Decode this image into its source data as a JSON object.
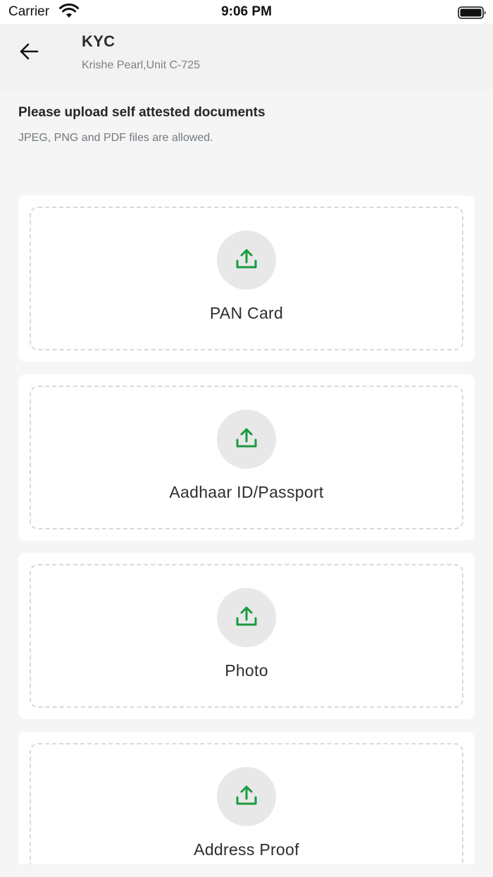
{
  "status_bar": {
    "carrier": "Carrier",
    "time": "9:06 PM"
  },
  "header": {
    "title": "KYC",
    "subtitle": "Krishe Pearl,Unit C-725",
    "back_icon": "arrow-left-icon"
  },
  "instructions": {
    "title": "Please upload self attested documents",
    "subtitle": "JPEG, PNG and PDF files are allowed."
  },
  "uploads": [
    {
      "label": "PAN Card",
      "icon": "upload-icon"
    },
    {
      "label": "Aadhaar ID/Passport",
      "icon": "upload-icon"
    },
    {
      "label": "Photo",
      "icon": "upload-icon"
    },
    {
      "label": "Address Proof",
      "icon": "upload-icon"
    }
  ],
  "colors": {
    "accent": "#1a9a3f",
    "background": "#f5f5f5",
    "card": "#ffffff",
    "icon_circle": "#e8e8e8"
  }
}
